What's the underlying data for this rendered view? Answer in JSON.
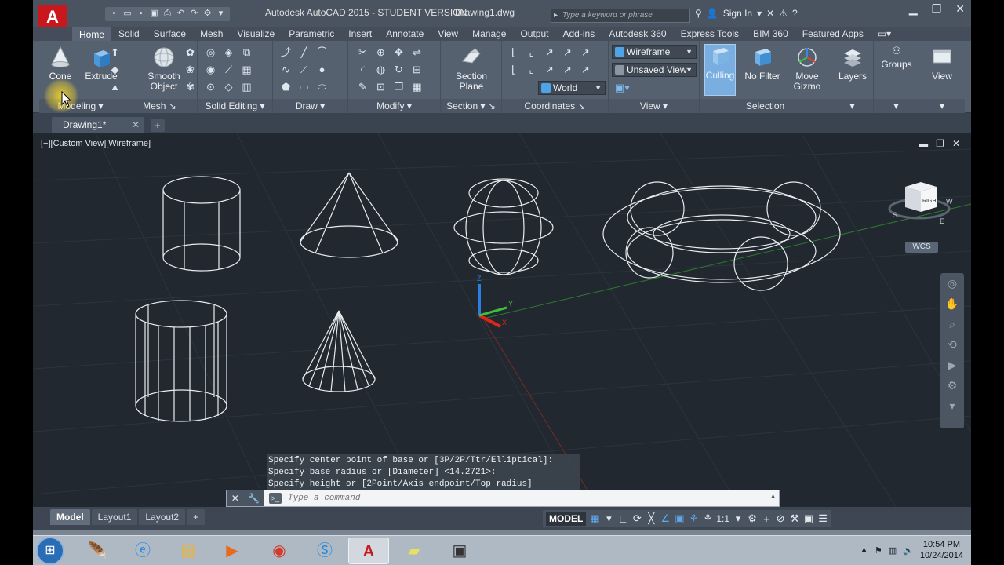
{
  "title_bar": {
    "app_logo": "A",
    "title": "Autodesk AutoCAD 2015 - STUDENT VERSION",
    "file_name": "Drawing1.dwg",
    "search_placeholder": "Type a keyword or phrase",
    "sign_in": "Sign In"
  },
  "ribbon_tabs": [
    "Home",
    "Solid",
    "Surface",
    "Mesh",
    "Visualize",
    "Parametric",
    "Insert",
    "Annotate",
    "View",
    "Manage",
    "Output",
    "Add-ins",
    "Autodesk 360",
    "Express Tools",
    "BIM 360",
    "Featured Apps"
  ],
  "ribbon": {
    "modeling": {
      "title": "Modeling",
      "cone_label": "Cone",
      "extrude_label": "Extrude"
    },
    "mesh": {
      "title": "Mesh",
      "smooth_line1": "Smooth",
      "smooth_line2": "Object"
    },
    "solid_editing": {
      "title": "Solid Editing"
    },
    "draw": {
      "title": "Draw"
    },
    "modify": {
      "title": "Modify"
    },
    "section": {
      "title": "Section",
      "plane_line1": "Section",
      "plane_line2": "Plane"
    },
    "coordinates": {
      "title": "Coordinates",
      "ucs_value": "World"
    },
    "view": {
      "title": "View",
      "visual_style": "Wireframe",
      "saved_view": "Unsaved View"
    },
    "selection": {
      "title": "Selection",
      "culling_label": "Culling",
      "no_filter_label": "No Filter",
      "move_gizmo_line1": "Move",
      "move_gizmo_line2": "Gizmo"
    },
    "layers": {
      "label": "Layers"
    },
    "groups": {
      "label": "Groups"
    },
    "view_btn": {
      "label": "View"
    }
  },
  "file_tabs": {
    "active": "Drawing1*",
    "new_tab_symbol": "+"
  },
  "viewport": {
    "label": "[−][Custom View][Wireframe]",
    "wcs": "WCS",
    "viewcube_face": "RIGHT",
    "compass": {
      "south": "S",
      "east": "E",
      "west": "W"
    },
    "axis_labels": {
      "x": "X",
      "y": "Y",
      "z": "Z"
    }
  },
  "command": {
    "history": [
      "Specify center point of base or [3P/2P/Ttr/Elliptical]:",
      "Specify base radius or [Diameter] <14.2721>:",
      "Specify height or [2Point/Axis endpoint/Top radius] <29.8291>:"
    ],
    "placeholder": "Type a command"
  },
  "layout_tabs": [
    "Model",
    "Layout1",
    "Layout2"
  ],
  "status": {
    "model": "MODEL",
    "scale": "1:1"
  },
  "taskbar": {
    "time": "10:54 PM",
    "date": "10/24/2014"
  },
  "colors": {
    "viewport_bg": "#212830",
    "wire": "#e8ecef",
    "axis_x": "#e0251b",
    "axis_y": "#3fbf3a",
    "axis_z": "#2b7fe0",
    "accent": "#c8181e"
  }
}
